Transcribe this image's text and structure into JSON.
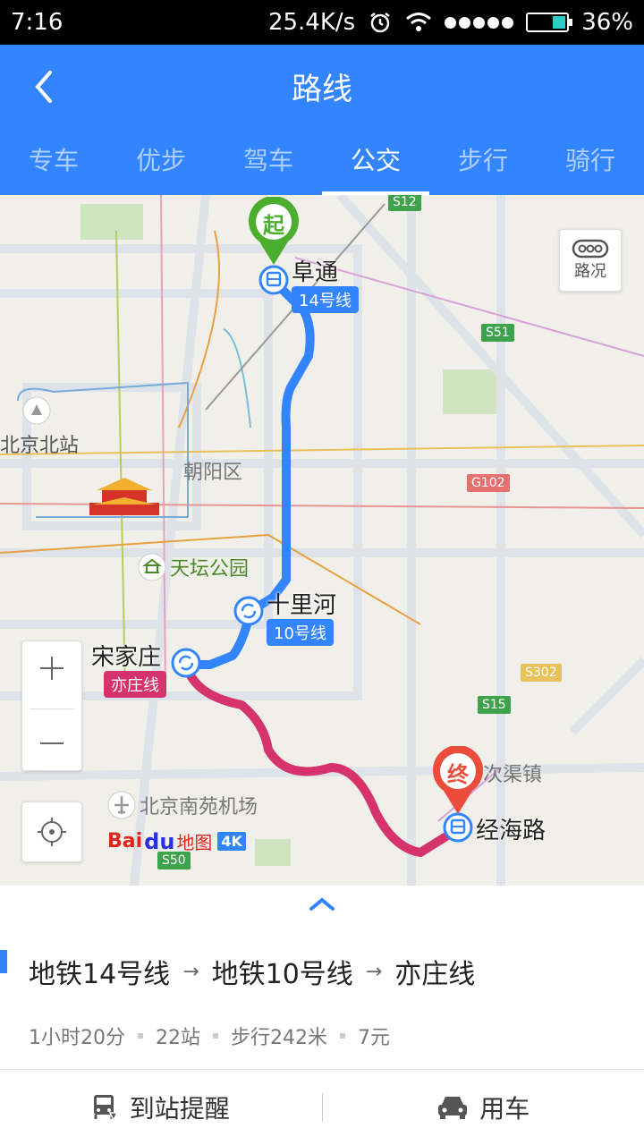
{
  "status_bar": {
    "time": "7:16",
    "speed": "25.4K/s",
    "battery": "36%",
    "battery_level": 0.36,
    "icons": [
      "alarm-icon",
      "wifi-icon",
      "signal-icon",
      "battery-icon"
    ]
  },
  "header": {
    "title": "路线",
    "tabs": [
      {
        "label": "专车",
        "active": false
      },
      {
        "label": "优步",
        "active": false
      },
      {
        "label": "驾车",
        "active": false
      },
      {
        "label": "公交",
        "active": true
      },
      {
        "label": "步行",
        "active": false
      },
      {
        "label": "骑行",
        "active": false
      }
    ]
  },
  "map": {
    "traffic_label": "路况",
    "start_pin": "起",
    "end_pin": "终",
    "stations": {
      "start": "阜通",
      "transfer1": "十里河",
      "transfer2": "宋家庄",
      "end": "经海路"
    },
    "lines": {
      "line14": "14号线",
      "line10": "10号线",
      "yizhuang": "亦庄线"
    },
    "pois": {
      "beijing_north": "北京北站",
      "chaoyang": "朝阳区",
      "temple_of_heaven": "天坛公园",
      "nanyuan_airport": "北京南苑机场",
      "ciqu": "次渠镇"
    },
    "road_shields": [
      "S12",
      "S51",
      "G102",
      "S302",
      "S15",
      "S50"
    ],
    "logo": {
      "text1": "Bai",
      "paw": "du",
      "text2": "地图",
      "badge": "4K"
    },
    "colors": {
      "line_blue": "#3385ff",
      "line_pink": "#d6336c",
      "start_green": "#4cae2f",
      "end_red": "#ec4c3c"
    }
  },
  "route": {
    "segments": [
      "地铁14号线",
      "地铁10号线",
      "亦庄线"
    ],
    "duration": "1小时20分",
    "stops": "22站",
    "walk": "步行242米",
    "price": "7元"
  },
  "actions": {
    "arrival_alert": "到站提醒",
    "car": "用车"
  }
}
